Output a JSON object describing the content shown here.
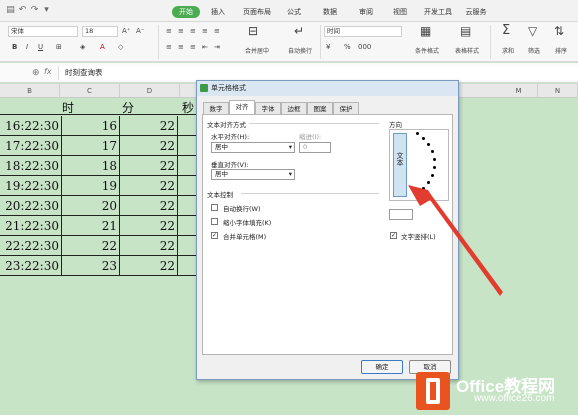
{
  "ribbon_tabs": [
    "开始",
    "插入",
    "页面布局",
    "公式",
    "数据",
    "审阅",
    "视图",
    "开发工具",
    "云服务"
  ],
  "ribbon": {
    "font_name": "宋体",
    "font_size": "18",
    "merge_center": "合并居中",
    "wrap_text": "自动换行",
    "number_format": "时间",
    "percent": "%",
    "thousands": "000",
    "cond_format": "条件格式",
    "table_style": "表格样式",
    "sum": "求和",
    "filter": "筛选",
    "sort": "排序"
  },
  "formula_bar": {
    "fx": "fx",
    "content": "时刻查询表"
  },
  "columns": [
    "B",
    "C",
    "D",
    "M",
    "N"
  ],
  "sheet": {
    "headers": [
      "时",
      "分",
      "秒"
    ],
    "rows": [
      [
        "16:22:30",
        "16",
        "22"
      ],
      [
        "17:22:30",
        "17",
        "22"
      ],
      [
        "18:22:30",
        "18",
        "22"
      ],
      [
        "19:22:30",
        "19",
        "22"
      ],
      [
        "20:22:30",
        "20",
        "22"
      ],
      [
        "21:22:30",
        "21",
        "22"
      ],
      [
        "22:22:30",
        "22",
        "22"
      ],
      [
        "23:22:30",
        "23",
        "22"
      ]
    ]
  },
  "dialog": {
    "title": "单元格格式",
    "tabs": [
      "数字",
      "对齐",
      "字体",
      "边框",
      "图案",
      "保护"
    ],
    "text_align_group": "文本对齐方式",
    "h_align_label": "水平对齐(H):",
    "h_align_value": "居中",
    "indent_label": "缩进(I):",
    "indent_value": "0",
    "v_align_label": "垂直对齐(V):",
    "v_align_value": "居中",
    "text_control_group": "文本控制",
    "wrap_label": "自动换行(W)",
    "shrink_label": "缩小字体填充(K)",
    "merge_label": "合并单元格(M)",
    "merge_checked": true,
    "orientation_group": "方向",
    "orientation_text": "文本",
    "vertical_text_label": "文字竖排(L)",
    "vertical_checked": true,
    "ok": "确定",
    "cancel": "取消"
  },
  "logo": {
    "name": "Office教程网",
    "url": "www.office26.com"
  }
}
